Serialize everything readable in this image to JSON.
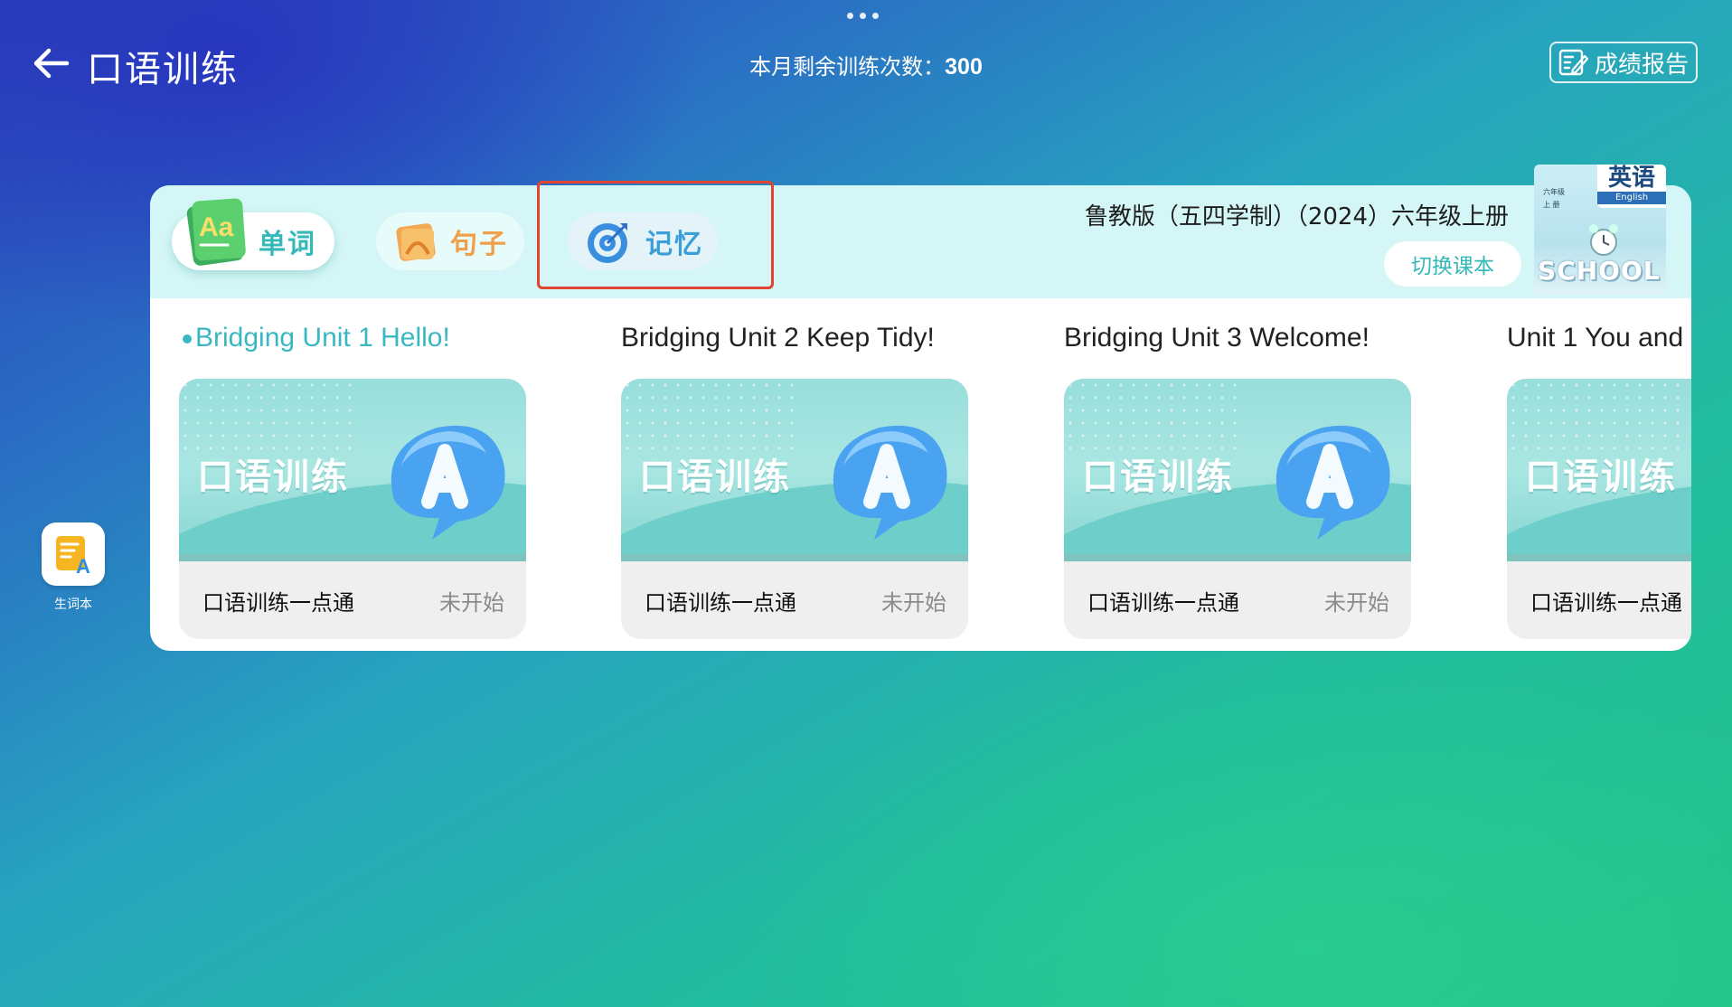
{
  "header": {
    "title": "口语训练",
    "remaining_label": "本月剩余训练次数：",
    "remaining_count": "300",
    "report_label": "成绩报告"
  },
  "sidebar": {
    "vocab_label": "生词本"
  },
  "tabs": [
    {
      "label": "单词",
      "color": "#34b8b8"
    },
    {
      "label": "句子",
      "color": "#f0a04a"
    },
    {
      "label": "记忆",
      "color": "#3a9ed8"
    }
  ],
  "book": {
    "title": "鲁教版（五四学制）（2024）六年级上册",
    "switch_label": "切换课本",
    "cover_subject": "英语",
    "cover_subject_en": "English",
    "cover_grade": "六年级",
    "cover_term": "上 册",
    "cover_word": "SCHOOL"
  },
  "units": [
    {
      "title": "Bridging Unit 1 Hello!",
      "active": true,
      "card_title": "口语训练",
      "name": "口语训练一点通",
      "status": "未开始"
    },
    {
      "title": "Bridging Unit 2 Keep Tidy!",
      "active": false,
      "card_title": "口语训练",
      "name": "口语训练一点通",
      "status": "未开始"
    },
    {
      "title": "Bridging Unit 3 Welcome!",
      "active": false,
      "card_title": "口语训练",
      "name": "口语训练一点通",
      "status": "未开始"
    },
    {
      "title": "Unit 1 You and",
      "active": false,
      "card_title": "口语训练",
      "name": "口语训练一点通",
      "status": ""
    }
  ],
  "colors": {
    "accent": "#34b8b8",
    "highlight": "#e0452f"
  }
}
